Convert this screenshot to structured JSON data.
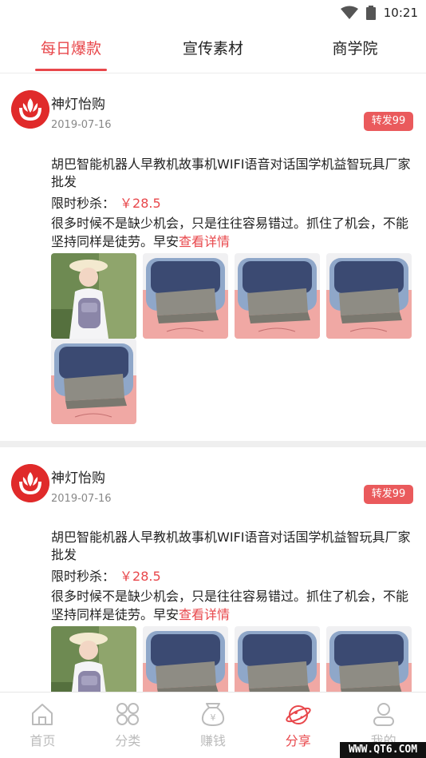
{
  "status_bar": {
    "time": "10:21",
    "icons": [
      "wifi-icon",
      "battery-icon"
    ]
  },
  "tabs": [
    {
      "label": "每日爆款",
      "active": true
    },
    {
      "label": "宣传素材",
      "active": false
    },
    {
      "label": "商学院",
      "active": false
    }
  ],
  "posts": [
    {
      "shop_name": "神灯怡购",
      "date": "2019-07-16",
      "forward_label": "转发99",
      "title": "胡巴智能机器人早教机故事机WIFI语音对话国学机益智玩具厂家批发",
      "price_label": "限时秒杀：",
      "price": "￥28.5",
      "desc": "很多时候不是缺少机会，只是往往容易错过。抓住了机会，不能坚持同样是徒劳。早安",
      "more_label": "查看详情"
    },
    {
      "shop_name": "神灯怡购",
      "date": "2019-07-16",
      "forward_label": "转发99",
      "title": "胡巴智能机器人早教机故事机WIFI语音对话国学机益智玩具厂家批发",
      "price_label": "限时秒杀：",
      "price": "￥28.5",
      "desc": "很多时候不是缺少机会，只是往往容易错过。抓住了机会，不能坚持同样是徒劳。早安",
      "more_label": "查看详情"
    }
  ],
  "bottom_nav": [
    {
      "label": "首页",
      "icon": "home-icon",
      "active": false
    },
    {
      "label": "分类",
      "icon": "category-icon",
      "active": false
    },
    {
      "label": "赚钱",
      "icon": "money-bag-icon",
      "active": false
    },
    {
      "label": "分享",
      "icon": "share-planet-icon",
      "active": true
    },
    {
      "label": "我的",
      "icon": "profile-icon",
      "active": false
    }
  ],
  "colors": {
    "accent": "#e8474b",
    "forward_bg": "#ea5a5c",
    "logo_red": "#e02a2a"
  },
  "watermark": "WWW.QT6.COM"
}
